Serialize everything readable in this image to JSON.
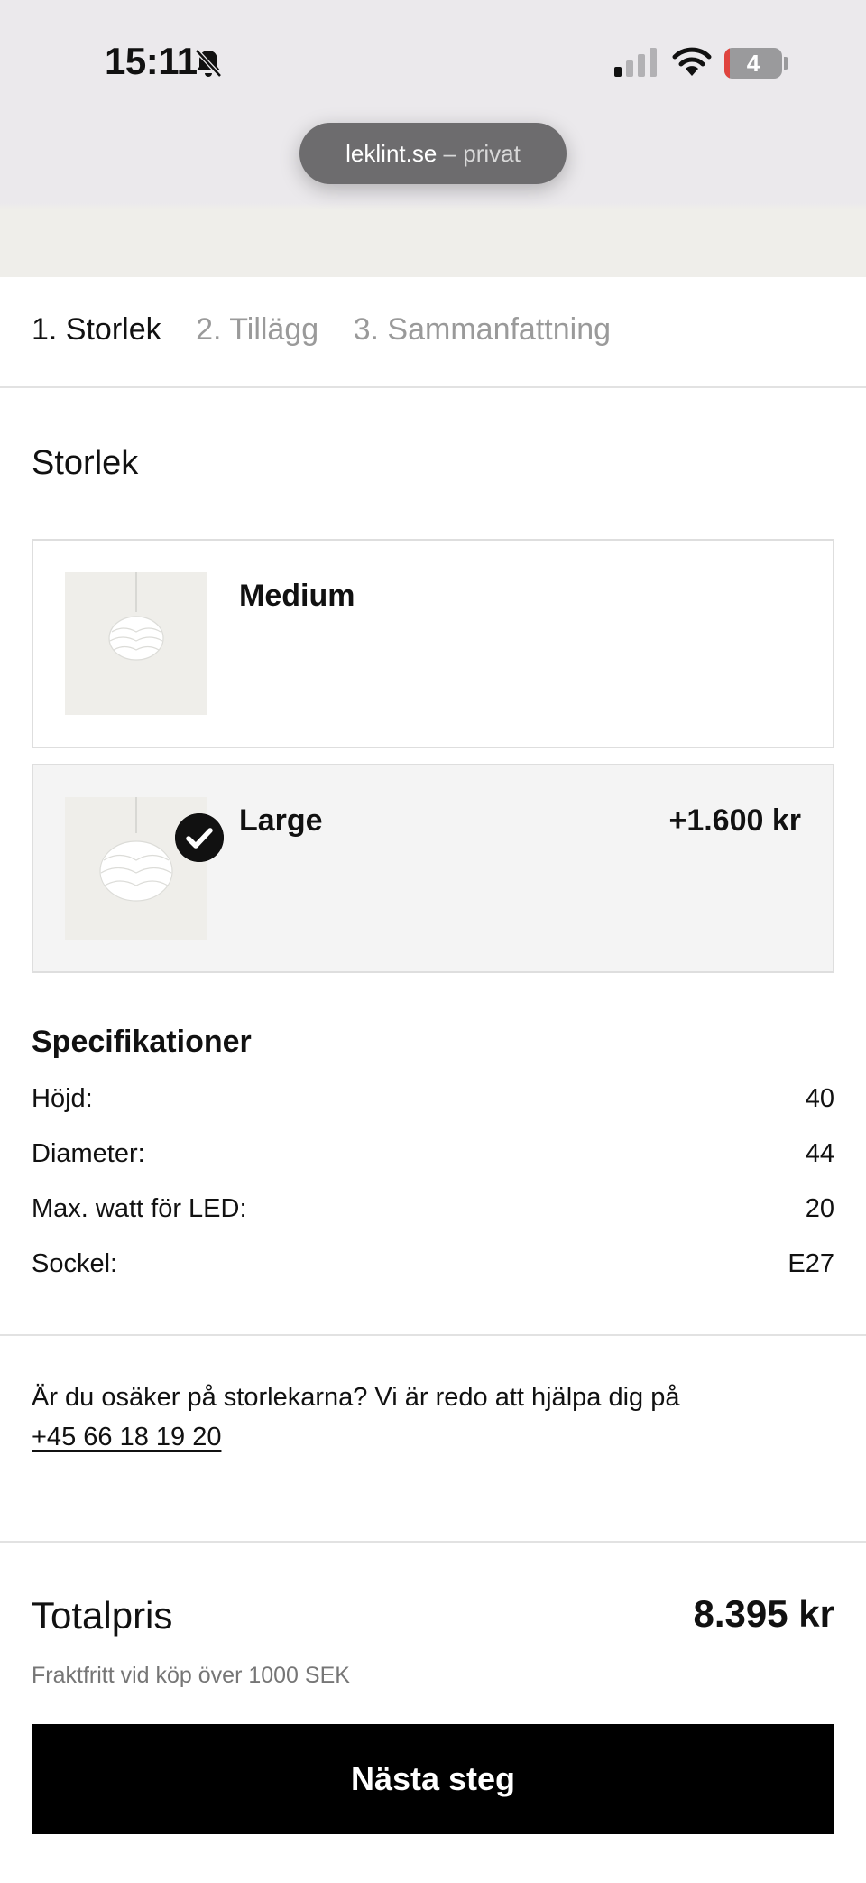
{
  "status_bar": {
    "time": "15:11",
    "battery": "4",
    "icons": [
      "bell-slash-icon",
      "cellular-signal-icon",
      "wifi-icon",
      "battery-icon"
    ]
  },
  "browser": {
    "domain": "leklint.se",
    "separator": "–",
    "mode": "privat"
  },
  "steps": [
    {
      "label": "1. Storlek",
      "active": true
    },
    {
      "label": "2. Tillägg",
      "active": false
    },
    {
      "label": "3. Sammanfattning",
      "active": false
    }
  ],
  "size_section": {
    "title": "Storlek",
    "options": [
      {
        "name": "Medium",
        "price": "",
        "selected": false
      },
      {
        "name": "Large",
        "price": "+1.600 kr",
        "selected": true
      }
    ]
  },
  "specs": {
    "title": "Specifikationer",
    "rows": [
      {
        "label": "Höjd:",
        "value": "40"
      },
      {
        "label": "Diameter:",
        "value": "44"
      },
      {
        "label": "Max. watt för LED:",
        "value": "20"
      },
      {
        "label": "Sockel:",
        "value": "E27"
      }
    ]
  },
  "help": {
    "text": "Är du osäker på storlekarna? Vi är redo att hjälpa dig på",
    "phone": "+45 66 18 19 20"
  },
  "total": {
    "label": "Totalpris",
    "value": "8.395 kr",
    "shipping_note": "Fraktfritt vid köp över 1000 SEK"
  },
  "cta": {
    "label": "Nästa steg"
  },
  "colors": {
    "accent": "#000000",
    "selected_bg": "#f4f4f4",
    "muted_text": "#9a9a9a"
  }
}
